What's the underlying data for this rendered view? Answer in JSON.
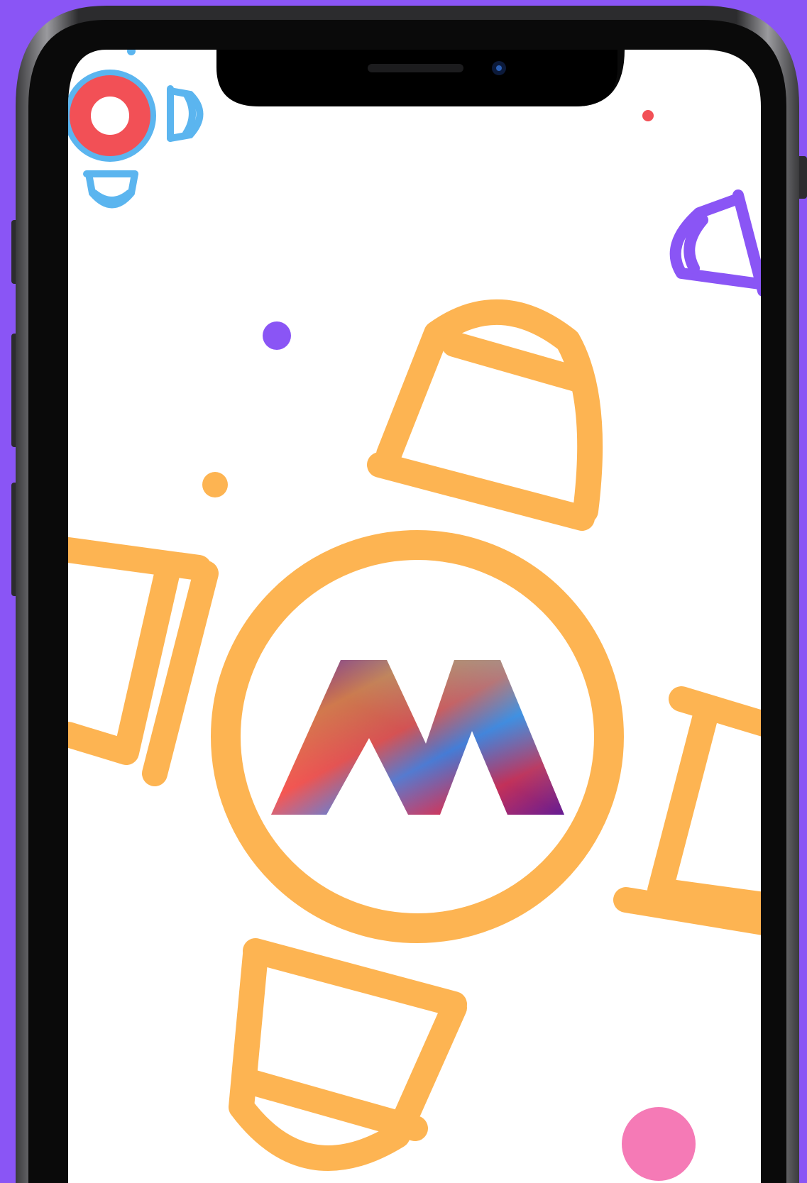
{
  "app": {
    "name": "splash-screen",
    "logo_letter": "M"
  },
  "colors": {
    "background": "#8a55f5",
    "phone_frame": "#1c1c1e",
    "phone_bezel": "#000000",
    "screen": "#ffffff",
    "accent_orange": "#fdb452",
    "accent_blue": "#5bb5ef",
    "accent_red": "#f25056",
    "accent_purple": "#8a55f5",
    "accent_pink": "#f57ab6"
  },
  "icons": {
    "logo": "gradient-m-logo-icon",
    "table": "round-table-icon",
    "chair": "chair-icon",
    "dot": "dot-icon"
  }
}
